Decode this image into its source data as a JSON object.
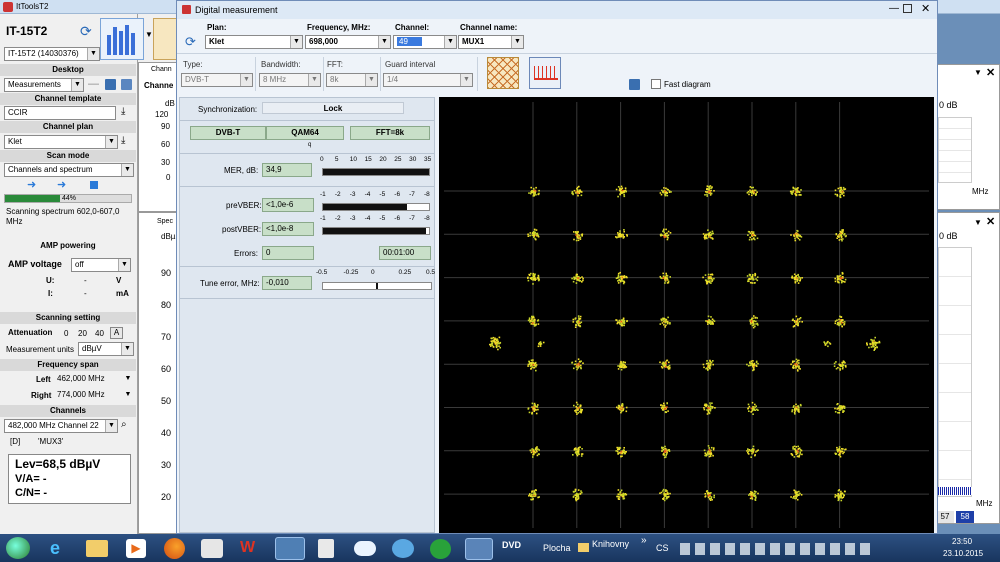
{
  "app": {
    "title": "ItToolsT2",
    "device_badge": "IT-15T2",
    "device_select": "IT-15T2 (14030376)"
  },
  "left": {
    "desktop_hdr": "Desktop",
    "desktop_val": "Measurements",
    "channel_template_hdr": "Channel template",
    "channel_template_val": "CCIR",
    "channel_plan_hdr": "Channel plan",
    "channel_plan_val": "Klet",
    "scan_mode_hdr": "Scan mode",
    "scan_mode_val": "Channels and spectrum",
    "progress_text": "44%",
    "progress_value": 0.44,
    "scan_status": "Scanning spectrum 602,0-607,0 MHz",
    "amp_hdr": "AMP powering",
    "amp_voltage_lbl": "AMP voltage",
    "amp_voltage_val": "off",
    "u_lbl": "U:",
    "u_val": "-",
    "u_unit": "V",
    "i_lbl": "I:",
    "i_val": "-",
    "i_unit": "mA",
    "scan_set_hdr": "Scanning setting",
    "attenuation_lbl": "Attenuation",
    "att_0": "0",
    "att_20": "20",
    "att_40": "40",
    "att_a": "A",
    "units_lbl": "Measurement units",
    "units_val": "dBµV",
    "freq_span_hdr": "Frequency span",
    "left_lbl": "Left",
    "left_val": "462,000 MHz",
    "right_lbl": "Right",
    "right_val": "774,000 MHz",
    "channels_hdr": "Channels",
    "channels_val": "482,000 MHz  Channel 22",
    "mux_tag": "[D]",
    "mux_name": "'MUX3'",
    "lev": "Lev=68,5 dBµV",
    "va": "V/A= -",
    "cn": "C/N= -"
  },
  "bg": {
    "tab1": "Chann",
    "tab1b": "Channe",
    "tab2": "Spec",
    "db1": "dB",
    "ticks1": [
      "120",
      "90",
      "60",
      "30",
      "0"
    ],
    "db2": "dBµ",
    "ticks2": [
      "90",
      "80",
      "70",
      "60",
      "50",
      "40",
      "30",
      "20"
    ],
    "right_top_val": "0 dB",
    "right_top_mhz": "MHz",
    "right_bot_val": "0 dB",
    "right_bot_mhz": "MHz",
    "right_bot_box1": "57",
    "right_bot_box2": "58"
  },
  "dlg": {
    "title": "Digital measurement",
    "plan_lbl": "Plan:",
    "plan_val": "Klet",
    "freq_lbl": "Frequency,  MHz:",
    "freq_val": "698,000",
    "channel_lbl": "Channel:",
    "channel_val": "49",
    "chname_lbl": "Channel name:",
    "chname_val": "MUX1",
    "type_lbl": "Type:",
    "type_val": "DVB-T",
    "bw_lbl": "Bandwidth:",
    "bw_val": "8 MHz",
    "fft_lbl": "FFT:",
    "fft_val": "8k",
    "gi_lbl": "Guard interval",
    "gi_val": "1/4",
    "fast_lbl": "Fast diagram",
    "sync_lbl": "Synchronization:",
    "sync_val": "Lock",
    "std": "DVB-T",
    "mod": "QAM64",
    "fftbadge": "FFT=8k",
    "q": "q",
    "mer_lbl": "MER, dB:",
    "mer_val": "34,9",
    "mer_ticks": [
      "0",
      "5",
      "10",
      "15",
      "20",
      "25",
      "30",
      "35"
    ],
    "mer_level": 0.997,
    "prevber_lbl": "preVBER:",
    "prevber_val": "<1,0e-6",
    "prevber_level": 0.79,
    "postvber_lbl": "postVBER:",
    "postvber_val": "<1,0e-8",
    "postvber_level": 0.97,
    "ber_ticks": [
      "-1",
      "-2",
      "-3",
      "-4",
      "-5",
      "-6",
      "-7",
      "-8"
    ],
    "errors_lbl": "Errors:",
    "errors_val": "0",
    "time_val": "00:01:00",
    "tune_lbl": "Tune error, MHz:",
    "tune_val": "-0,010",
    "tune_ticks": [
      "-0.5",
      "-0.25",
      "0",
      "0.25",
      "0.5"
    ],
    "tune_level": -0.01
  },
  "taskbar": {
    "plocha": "Plocha",
    "knihovny": "Knihovny",
    "more": "»",
    "lang": "CS",
    "time": "23:50",
    "date": "23.10.2015"
  }
}
